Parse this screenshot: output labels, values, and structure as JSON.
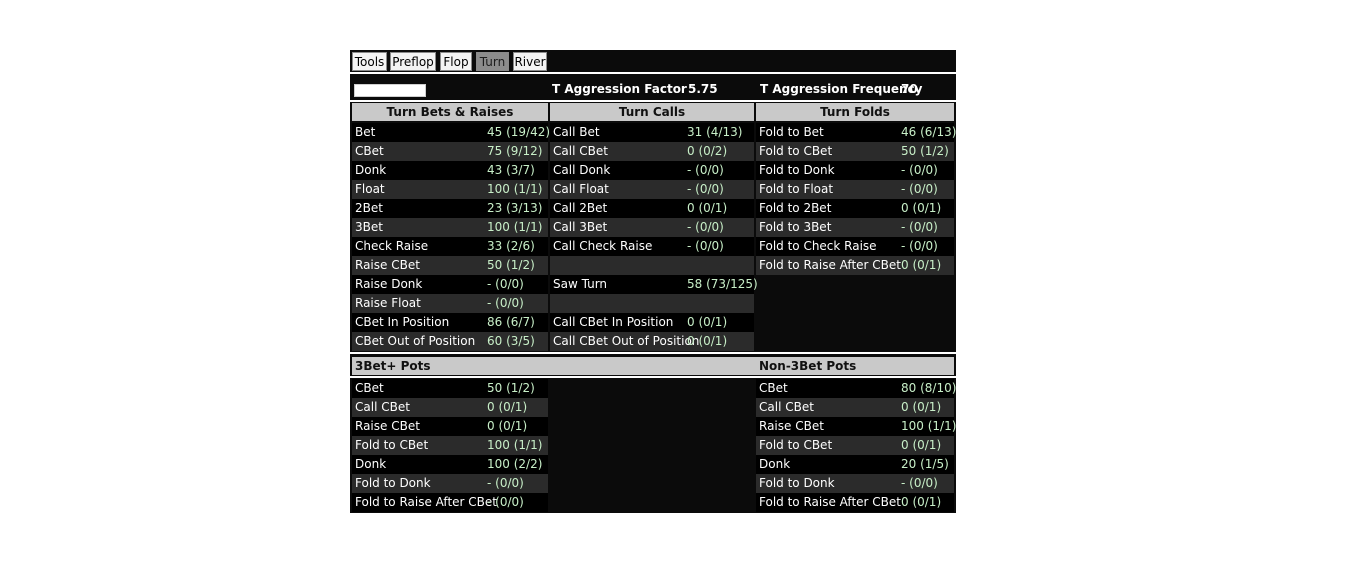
{
  "tabs": [
    {
      "label": "Tools",
      "active": false
    },
    {
      "label": "Preflop",
      "active": false
    },
    {
      "label": "Flop",
      "active": false
    },
    {
      "label": "Turn",
      "active": true
    },
    {
      "label": "River",
      "active": false
    }
  ],
  "header": {
    "aggression_factor_label": "T Aggression Factor",
    "aggression_factor_value": "5.75",
    "aggression_frequency_label": "T Aggression Frequency",
    "aggression_frequency_value": "70"
  },
  "sections": {
    "bets": {
      "title": "Turn Bets & Raises",
      "rows": [
        {
          "label": "Bet",
          "value": "45 (19/42)"
        },
        {
          "label": "CBet",
          "value": "75 (9/12)"
        },
        {
          "label": "Donk",
          "value": "43 (3/7)"
        },
        {
          "label": "Float",
          "value": "100 (1/1)"
        },
        {
          "label": "2Bet",
          "value": "23 (3/13)"
        },
        {
          "label": "3Bet",
          "value": "100 (1/1)"
        },
        {
          "label": "Check Raise",
          "value": "33 (2/6)"
        },
        {
          "label": "Raise CBet",
          "value": "50 (1/2)"
        },
        {
          "label": "Raise Donk",
          "value": "- (0/0)"
        },
        {
          "label": "Raise Float",
          "value": "- (0/0)"
        },
        {
          "label": "CBet In Position",
          "value": "86 (6/7)"
        },
        {
          "label": "CBet Out of Position",
          "value": "60 (3/5)"
        }
      ]
    },
    "calls": {
      "title": "Turn Calls",
      "rows": [
        {
          "label": "Call Bet",
          "value": "31 (4/13)"
        },
        {
          "label": "Call CBet",
          "value": "0 (0/2)"
        },
        {
          "label": "Call Donk",
          "value": "- (0/0)"
        },
        {
          "label": "Call Float",
          "value": "- (0/0)"
        },
        {
          "label": "Call 2Bet",
          "value": "0 (0/1)"
        },
        {
          "label": "Call 3Bet",
          "value": "- (0/0)"
        },
        {
          "label": "Call Check Raise",
          "value": "- (0/0)"
        },
        {
          "label": "",
          "value": ""
        },
        {
          "label": "Saw Turn",
          "value": "58 (73/125)"
        },
        {
          "label": "",
          "value": ""
        },
        {
          "label": "Call CBet In Position",
          "value": "0 (0/1)"
        },
        {
          "label": "Call CBet Out of Position",
          "value": "0 (0/1)"
        }
      ]
    },
    "folds": {
      "title": "Turn Folds",
      "rows": [
        {
          "label": "Fold to Bet",
          "value": "46 (6/13)"
        },
        {
          "label": "Fold to CBet",
          "value": "50 (1/2)"
        },
        {
          "label": "Fold to Donk",
          "value": "- (0/0)"
        },
        {
          "label": "Fold to Float",
          "value": "- (0/0)"
        },
        {
          "label": "Fold to 2Bet",
          "value": "0 (0/1)"
        },
        {
          "label": "Fold to 3Bet",
          "value": "- (0/0)"
        },
        {
          "label": "Fold to Check Raise",
          "value": "- (0/0)"
        },
        {
          "label": "Fold to Raise After CBet",
          "value": "0 (0/1)"
        }
      ]
    },
    "threebet": {
      "title": "3Bet+ Pots",
      "rows": [
        {
          "label": "CBet",
          "value": "50 (1/2)"
        },
        {
          "label": "Call CBet",
          "value": "0 (0/1)"
        },
        {
          "label": "Raise CBet",
          "value": "0 (0/1)"
        },
        {
          "label": "Fold to CBet",
          "value": "100 (1/1)"
        },
        {
          "label": "Donk",
          "value": "100 (2/2)"
        },
        {
          "label": "Fold to Donk",
          "value": "- (0/0)"
        },
        {
          "label": "Fold to Raise After CBet",
          "value": "- (0/0)"
        }
      ]
    },
    "non3bet": {
      "title": "Non-3Bet Pots",
      "rows": [
        {
          "label": "CBet",
          "value": "80 (8/10)"
        },
        {
          "label": "Call CBet",
          "value": "0 (0/1)"
        },
        {
          "label": "Raise CBet",
          "value": "100 (1/1)"
        },
        {
          "label": "Fold to CBet",
          "value": "0 (0/1)"
        },
        {
          "label": "Donk",
          "value": "20 (1/5)"
        },
        {
          "label": "Fold to Donk",
          "value": "- (0/0)"
        },
        {
          "label": "Fold to Raise After CBet",
          "value": "0 (0/1)"
        }
      ]
    }
  }
}
